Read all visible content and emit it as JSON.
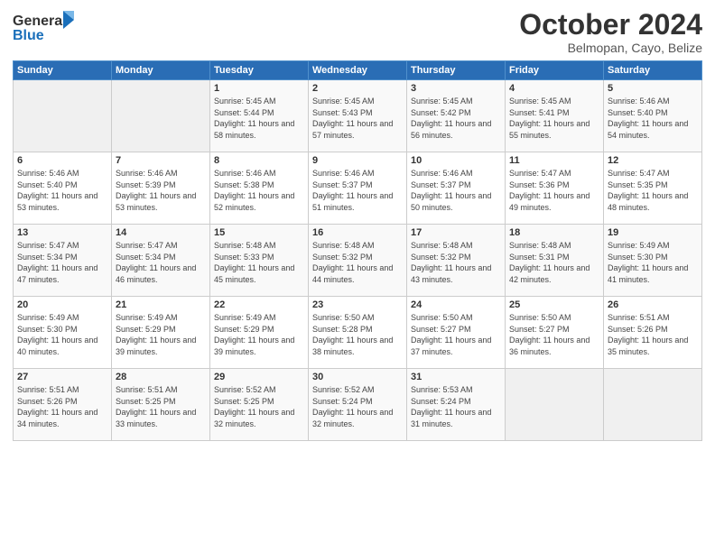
{
  "logo": {
    "general": "General",
    "blue": "Blue"
  },
  "title": "October 2024",
  "subtitle": "Belmopan, Cayo, Belize",
  "days_header": [
    "Sunday",
    "Monday",
    "Tuesday",
    "Wednesday",
    "Thursday",
    "Friday",
    "Saturday"
  ],
  "weeks": [
    [
      {
        "day": "",
        "info": ""
      },
      {
        "day": "",
        "info": ""
      },
      {
        "day": "1",
        "info": "Sunrise: 5:45 AM\nSunset: 5:44 PM\nDaylight: 11 hours and 58 minutes."
      },
      {
        "day": "2",
        "info": "Sunrise: 5:45 AM\nSunset: 5:43 PM\nDaylight: 11 hours and 57 minutes."
      },
      {
        "day": "3",
        "info": "Sunrise: 5:45 AM\nSunset: 5:42 PM\nDaylight: 11 hours and 56 minutes."
      },
      {
        "day": "4",
        "info": "Sunrise: 5:45 AM\nSunset: 5:41 PM\nDaylight: 11 hours and 55 minutes."
      },
      {
        "day": "5",
        "info": "Sunrise: 5:46 AM\nSunset: 5:40 PM\nDaylight: 11 hours and 54 minutes."
      }
    ],
    [
      {
        "day": "6",
        "info": "Sunrise: 5:46 AM\nSunset: 5:40 PM\nDaylight: 11 hours and 53 minutes."
      },
      {
        "day": "7",
        "info": "Sunrise: 5:46 AM\nSunset: 5:39 PM\nDaylight: 11 hours and 53 minutes."
      },
      {
        "day": "8",
        "info": "Sunrise: 5:46 AM\nSunset: 5:38 PM\nDaylight: 11 hours and 52 minutes."
      },
      {
        "day": "9",
        "info": "Sunrise: 5:46 AM\nSunset: 5:37 PM\nDaylight: 11 hours and 51 minutes."
      },
      {
        "day": "10",
        "info": "Sunrise: 5:46 AM\nSunset: 5:37 PM\nDaylight: 11 hours and 50 minutes."
      },
      {
        "day": "11",
        "info": "Sunrise: 5:47 AM\nSunset: 5:36 PM\nDaylight: 11 hours and 49 minutes."
      },
      {
        "day": "12",
        "info": "Sunrise: 5:47 AM\nSunset: 5:35 PM\nDaylight: 11 hours and 48 minutes."
      }
    ],
    [
      {
        "day": "13",
        "info": "Sunrise: 5:47 AM\nSunset: 5:34 PM\nDaylight: 11 hours and 47 minutes."
      },
      {
        "day": "14",
        "info": "Sunrise: 5:47 AM\nSunset: 5:34 PM\nDaylight: 11 hours and 46 minutes."
      },
      {
        "day": "15",
        "info": "Sunrise: 5:48 AM\nSunset: 5:33 PM\nDaylight: 11 hours and 45 minutes."
      },
      {
        "day": "16",
        "info": "Sunrise: 5:48 AM\nSunset: 5:32 PM\nDaylight: 11 hours and 44 minutes."
      },
      {
        "day": "17",
        "info": "Sunrise: 5:48 AM\nSunset: 5:32 PM\nDaylight: 11 hours and 43 minutes."
      },
      {
        "day": "18",
        "info": "Sunrise: 5:48 AM\nSunset: 5:31 PM\nDaylight: 11 hours and 42 minutes."
      },
      {
        "day": "19",
        "info": "Sunrise: 5:49 AM\nSunset: 5:30 PM\nDaylight: 11 hours and 41 minutes."
      }
    ],
    [
      {
        "day": "20",
        "info": "Sunrise: 5:49 AM\nSunset: 5:30 PM\nDaylight: 11 hours and 40 minutes."
      },
      {
        "day": "21",
        "info": "Sunrise: 5:49 AM\nSunset: 5:29 PM\nDaylight: 11 hours and 39 minutes."
      },
      {
        "day": "22",
        "info": "Sunrise: 5:49 AM\nSunset: 5:29 PM\nDaylight: 11 hours and 39 minutes."
      },
      {
        "day": "23",
        "info": "Sunrise: 5:50 AM\nSunset: 5:28 PM\nDaylight: 11 hours and 38 minutes."
      },
      {
        "day": "24",
        "info": "Sunrise: 5:50 AM\nSunset: 5:27 PM\nDaylight: 11 hours and 37 minutes."
      },
      {
        "day": "25",
        "info": "Sunrise: 5:50 AM\nSunset: 5:27 PM\nDaylight: 11 hours and 36 minutes."
      },
      {
        "day": "26",
        "info": "Sunrise: 5:51 AM\nSunset: 5:26 PM\nDaylight: 11 hours and 35 minutes."
      }
    ],
    [
      {
        "day": "27",
        "info": "Sunrise: 5:51 AM\nSunset: 5:26 PM\nDaylight: 11 hours and 34 minutes."
      },
      {
        "day": "28",
        "info": "Sunrise: 5:51 AM\nSunset: 5:25 PM\nDaylight: 11 hours and 33 minutes."
      },
      {
        "day": "29",
        "info": "Sunrise: 5:52 AM\nSunset: 5:25 PM\nDaylight: 11 hours and 32 minutes."
      },
      {
        "day": "30",
        "info": "Sunrise: 5:52 AM\nSunset: 5:24 PM\nDaylight: 11 hours and 32 minutes."
      },
      {
        "day": "31",
        "info": "Sunrise: 5:53 AM\nSunset: 5:24 PM\nDaylight: 11 hours and 31 minutes."
      },
      {
        "day": "",
        "info": ""
      },
      {
        "day": "",
        "info": ""
      }
    ]
  ]
}
